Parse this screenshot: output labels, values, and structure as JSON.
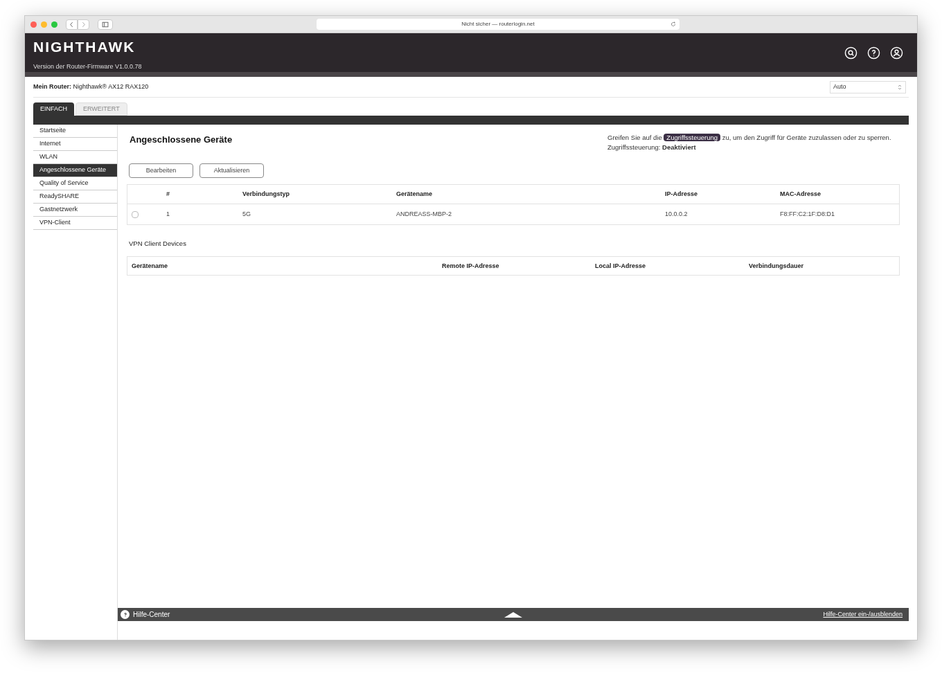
{
  "browser": {
    "address": "Nicht sicher — routerlogin.net"
  },
  "header": {
    "logo": "NIGHTHAWK",
    "firmware": "Version der Router-Firmware V1.0.0.78"
  },
  "router": {
    "label": "Mein Router:",
    "name": "Nighthawk® AX12 RAX120",
    "language": "Auto"
  },
  "tabs": [
    {
      "label": "EINFACH",
      "selected": true
    },
    {
      "label": "ERWEITERT",
      "selected": false
    }
  ],
  "sidebar": {
    "items": [
      {
        "label": "Startseite",
        "selected": false
      },
      {
        "label": "Internet",
        "selected": false
      },
      {
        "label": "WLAN",
        "selected": false
      },
      {
        "label": "Angeschlossene Geräte",
        "selected": true
      },
      {
        "label": "Quality of Service",
        "selected": false
      },
      {
        "label": "ReadySHARE",
        "selected": false
      },
      {
        "label": "Gastnetzwerk",
        "selected": false
      },
      {
        "label": "VPN-Client",
        "selected": false
      }
    ]
  },
  "page": {
    "title": "Angeschlossene Geräte",
    "note_before": "Greifen Sie auf die",
    "note_link": "Zugriffssteuerung",
    "note_after": "zu, um den Zugriff für Geräte zuzulassen oder zu sperren.",
    "status_label": "Zugriffssteuerung:",
    "status_value": "Deaktiviert",
    "buttons": [
      "Bearbeiten",
      "Aktualisieren"
    ]
  },
  "devices": {
    "columns": [
      "#",
      "Verbindungstyp",
      "Gerätename",
      "IP-Adresse",
      "MAC-Adresse"
    ],
    "rows": [
      {
        "checked": false,
        "cells": [
          "1",
          "5G",
          "ANDREASS-MBP-2",
          "10.0.0.2",
          "F8:FF:C2:1F:D8:D1"
        ]
      }
    ]
  },
  "vpn": {
    "title": "VPN Client Devices",
    "columns": [
      "Gerätename",
      "Remote IP-Adresse",
      "Local IP-Adresse",
      "Verbindungsdauer"
    ]
  },
  "help_bar": {
    "label": "Hilfe-Center",
    "toggle": "Hilfe-Center ein-/ausblenden"
  }
}
